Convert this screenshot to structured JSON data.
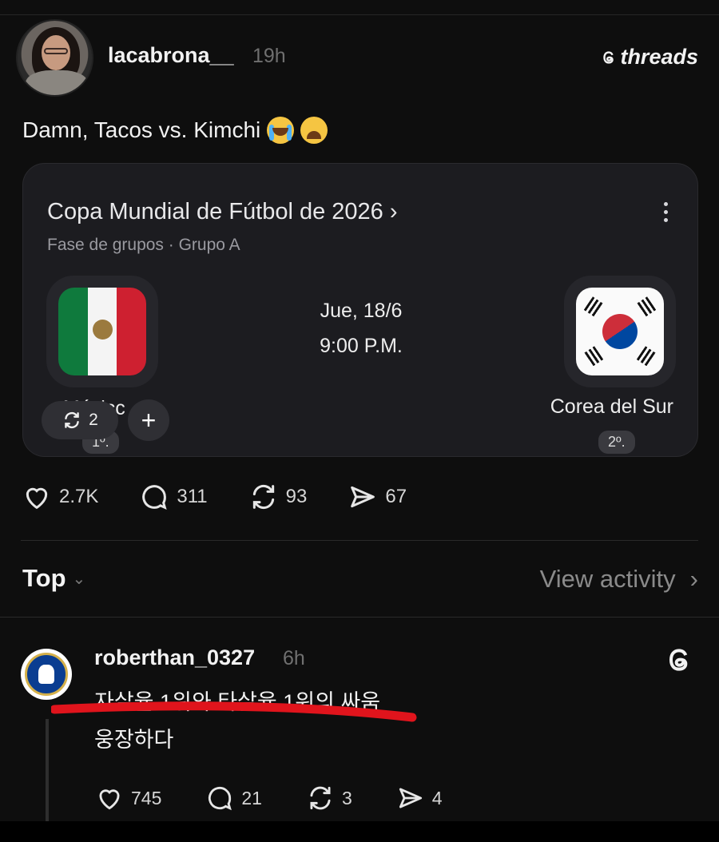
{
  "post": {
    "username": "lacabrona__",
    "time": "19h",
    "brand": "threads",
    "text": "Damn, Tacos vs. Kimchi",
    "emoji_1": "loudly-crying-face",
    "emoji_2": "weary-face"
  },
  "match_card": {
    "title": "Copa Mundial de Fútbol de 2026",
    "title_chevron": "›",
    "subtitle": "Fase de grupos · Grupo A",
    "date": "Jue, 18/6",
    "time": "9:00 P.M.",
    "team_home": "Méxicc",
    "team_home_rank": "1º.",
    "team_away": "Corea del Sur",
    "team_away_rank": "2º."
  },
  "overlay": {
    "repost_count": "2",
    "add_label": "+"
  },
  "post_actions": {
    "likes": "2.7K",
    "replies": "311",
    "reposts": "93",
    "shares": "67"
  },
  "sort": {
    "label": "Top",
    "chevron": "⌄",
    "view_activity": "View activity",
    "view_chevron": "›"
  },
  "reply": {
    "username": "roberthan_0327",
    "time": "6h",
    "line1": "자살율 1위와 타살율 1위의 싸움",
    "line2": "웅장하다",
    "likes": "745",
    "replies": "21",
    "reposts": "3",
    "shares": "4"
  },
  "colors": {
    "background": "#0e0e0e",
    "card": "#1c1c20",
    "red_annotation": "#e0141c"
  }
}
